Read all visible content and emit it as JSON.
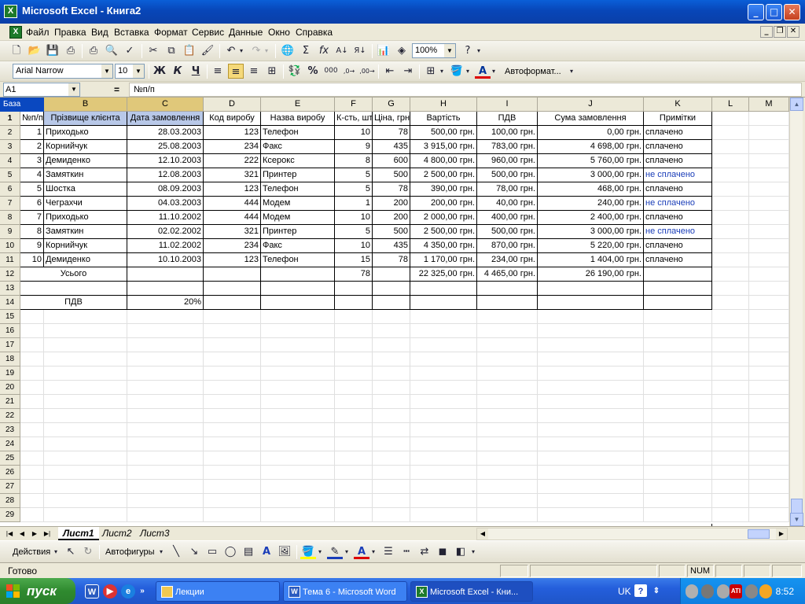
{
  "window": {
    "title": "Microsoft Excel - Книга2",
    "icon": "excel-icon"
  },
  "menu": [
    "Файл",
    "Правка",
    "Вид",
    "Вставка",
    "Формат",
    "Сервис",
    "Данные",
    "Окно",
    "Справка"
  ],
  "toolbar": {
    "zoom": "100%",
    "font_name": "Arial Narrow",
    "font_size": "10",
    "bold": "Ж",
    "italic": "К",
    "underline": "Ч",
    "autoformat": "Автоформат..."
  },
  "formula": {
    "name_box": "A1",
    "equals": "=",
    "content": "№п/п"
  },
  "grid": {
    "range_name": "База",
    "columns": [
      "A",
      "B",
      "C",
      "D",
      "E",
      "F",
      "G",
      "H",
      "I",
      "J",
      "K",
      "L",
      "M"
    ],
    "rows": [
      [
        "№п/п",
        "Прізвище клієнта",
        "Дата замовлення",
        "Код виробу",
        "Назва виробу",
        "К-сть, шт",
        "Ціна, грн",
        "Вартість",
        "ПДВ",
        "Сума замовлення",
        "Примітки"
      ],
      [
        "1",
        "Приходько",
        "28.03.2003",
        "123",
        "Телефон",
        "10",
        "78",
        "500,00 грн.",
        "100,00 грн.",
        "0,00 грн.",
        "сплачено"
      ],
      [
        "2",
        "Корнийчук",
        "25.08.2003",
        "234",
        "Факс",
        "9",
        "435",
        "3 915,00 грн.",
        "783,00 грн.",
        "4 698,00 грн.",
        "сплачено"
      ],
      [
        "3",
        "Демиденко",
        "12.10.2003",
        "222",
        "Ксерокс",
        "8",
        "600",
        "4 800,00 грн.",
        "960,00 грн.",
        "5 760,00 грн.",
        "сплачено"
      ],
      [
        "4",
        "Замяткин",
        "12.08.2003",
        "321",
        "Принтер",
        "5",
        "500",
        "2 500,00 грн.",
        "500,00 грн.",
        "3 000,00 грн.",
        "не сплачено"
      ],
      [
        "5",
        "Шостка",
        "08.09.2003",
        "123",
        "Телефон",
        "5",
        "78",
        "390,00 грн.",
        "78,00 грн.",
        "468,00 грн.",
        "сплачено"
      ],
      [
        "6",
        "Чеграхчи",
        "04.03.2003",
        "444",
        "Модем",
        "1",
        "200",
        "200,00 грн.",
        "40,00 грн.",
        "240,00 грн.",
        "не сплачено"
      ],
      [
        "7",
        "Приходько",
        "11.10.2002",
        "444",
        "Модем",
        "10",
        "200",
        "2 000,00 грн.",
        "400,00 грн.",
        "2 400,00 грн.",
        "сплачено"
      ],
      [
        "8",
        "Замяткин",
        "02.02.2002",
        "321",
        "Принтер",
        "5",
        "500",
        "2 500,00 грн.",
        "500,00 грн.",
        "3 000,00 грн.",
        "не сплачено"
      ],
      [
        "9",
        "Корнийчук",
        "11.02.2002",
        "234",
        "Факс",
        "10",
        "435",
        "4 350,00 грн.",
        "870,00 грн.",
        "5 220,00 грн.",
        "сплачено"
      ],
      [
        "10",
        "Демиденко",
        "10.10.2003",
        "123",
        "Телефон",
        "15",
        "78",
        "1 170,00 грн.",
        "234,00 грн.",
        "1 404,00 грн.",
        "сплачено"
      ]
    ],
    "total": {
      "label": "Усього",
      "qty": "78",
      "cost": "22 325,00 грн.",
      "vat": "4 465,00 грн.",
      "sum": "26 190,00 грн."
    },
    "vat_row": {
      "label": "ПДВ",
      "value": "20%"
    },
    "row_count": 29
  },
  "sheets": [
    "Лист1",
    "Лист2",
    "Лист3"
  ],
  "drawing": {
    "actions": "Действия",
    "autoshapes": "Автофигуры"
  },
  "status": {
    "text": "Готово",
    "num": "NUM"
  },
  "taskbar": {
    "start": "пуск",
    "tasks": [
      "Лекции",
      "Тема 6 - Microsoft Word",
      "Microsoft Excel - Кни..."
    ],
    "lang": "UK",
    "clock": "8:52"
  }
}
